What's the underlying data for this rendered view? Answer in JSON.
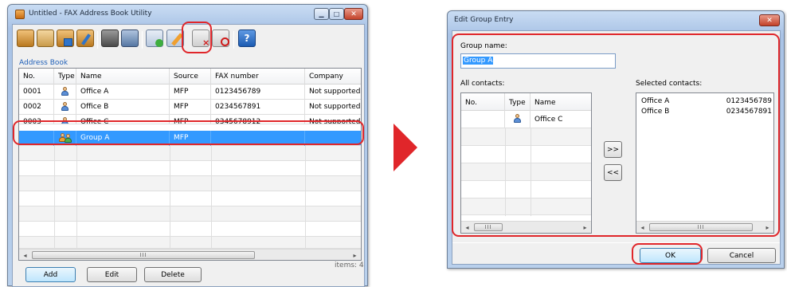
{
  "left_window": {
    "title": "Untitled - FAX Address Book Utility",
    "toolbar_icons": [
      "open-book-icon",
      "address-book-icon",
      "save-icon",
      "edit-book-icon",
      "fax-machine-icon",
      "fax-user-icon",
      "add-contact-icon",
      "edit-group-icon",
      "delete-entry-icon",
      "block-entry-icon",
      "help-icon"
    ],
    "section_label": "Address Book",
    "columns": [
      "No.",
      "Type",
      "Name",
      "Source",
      "FAX number",
      "Company"
    ],
    "rows": [
      {
        "no": "0001",
        "type": "person-icon",
        "name": "Office A",
        "source": "MFP",
        "fax": "0123456789",
        "company": "Not supported"
      },
      {
        "no": "0002",
        "type": "person-icon",
        "name": "Office B",
        "source": "MFP",
        "fax": "0234567891",
        "company": "Not supported"
      },
      {
        "no": "0003",
        "type": "person-icon",
        "name": "Office C",
        "source": "MFP",
        "fax": "0345678912",
        "company": "Not supported"
      },
      {
        "no": "",
        "type": "group-icon",
        "name": "Group A",
        "source": "MFP",
        "fax": "",
        "company": ""
      }
    ],
    "buttons": {
      "add": "Add",
      "edit": "Edit",
      "delete": "Delete"
    },
    "items_count": "items: 4",
    "scroll_thumb": "III"
  },
  "arrow_color": "#e0262a",
  "highlight_color": "#e0262a",
  "right_window": {
    "title": "Edit Group Entry",
    "group_name_label": "Group name:",
    "group_name_value": "Group A",
    "all_contacts_label": "All contacts:",
    "selected_contacts_label": "Selected contacts:",
    "all_columns": [
      "No.",
      "Type",
      "Name"
    ],
    "all_rows": [
      {
        "no": "",
        "type": "person-icon",
        "name": "Office C"
      }
    ],
    "selected_rows": [
      {
        "name": "Office A",
        "fax": "0123456789"
      },
      {
        "name": "Office B",
        "fax": "0234567891"
      }
    ],
    "add_button": ">>",
    "remove_button": "<<",
    "ok_label": "OK",
    "cancel_label": "Cancel",
    "scroll_thumb": "III"
  }
}
